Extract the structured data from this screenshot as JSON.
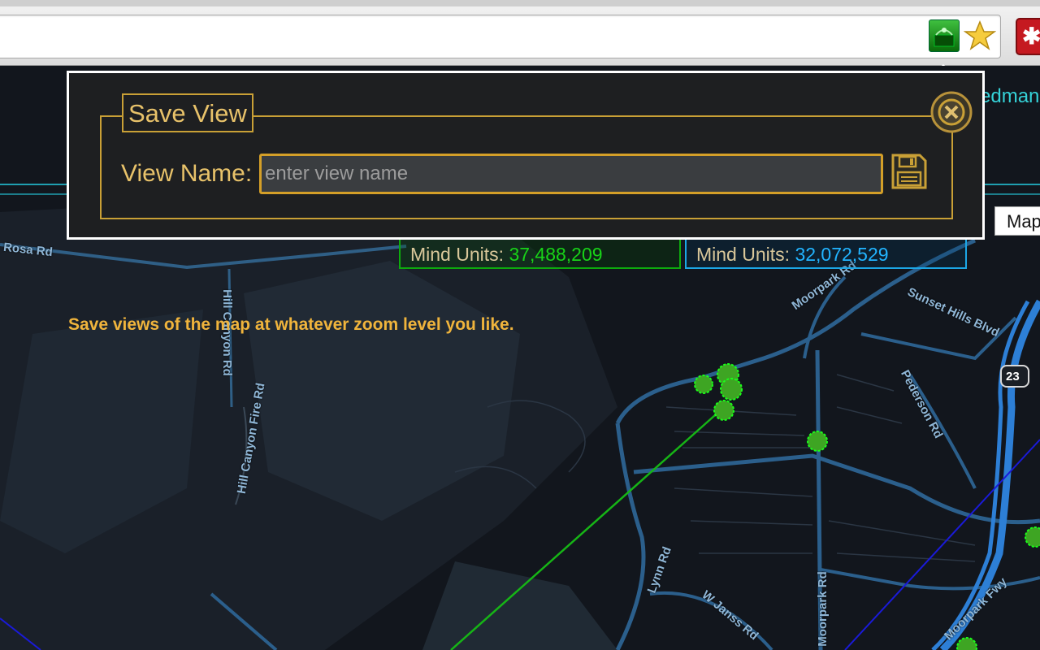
{
  "toolbar": {
    "extension_icon": "ingress-map-icon",
    "bookmark_icon": "star-icon",
    "other_extension_icon": "red-puzzle-icon"
  },
  "map": {
    "user_name_partial": "edman",
    "map_type_button": "Map",
    "road_labels": {
      "rosa": "Rosa Rd",
      "hill_canyon": "Hill Canyon Rd",
      "hill_canyon_fire": "Hill Canyon Fire Rd",
      "moorpark_rd_top": "Moorpark Rd",
      "sunset_hills": "Sunset Hills Blvd",
      "pederson": "Pederson Rd",
      "route_23": "23",
      "lynn": "Lynn Rd",
      "w_janss": "W Janss Rd",
      "moorpark_rd": "Moorpark Rd",
      "moorpark_fwy": "Moorpark Fwy"
    },
    "mind_units": {
      "label": "Mind Units:",
      "enlightened": "37,488,209",
      "resistance": "32,072,529"
    },
    "tip": "Save views of the map at whatever zoom level you like."
  },
  "popup": {
    "title": "Save View",
    "field_label": "View Name:",
    "input_placeholder": "enter view name",
    "input_value": "",
    "save_icon": "floppy-disk-icon",
    "close_icon": "close-icon"
  },
  "colors": {
    "accent_gold": "#c9a036",
    "enlightened_green": "#18d318",
    "resistance_blue": "#22b4ff"
  }
}
